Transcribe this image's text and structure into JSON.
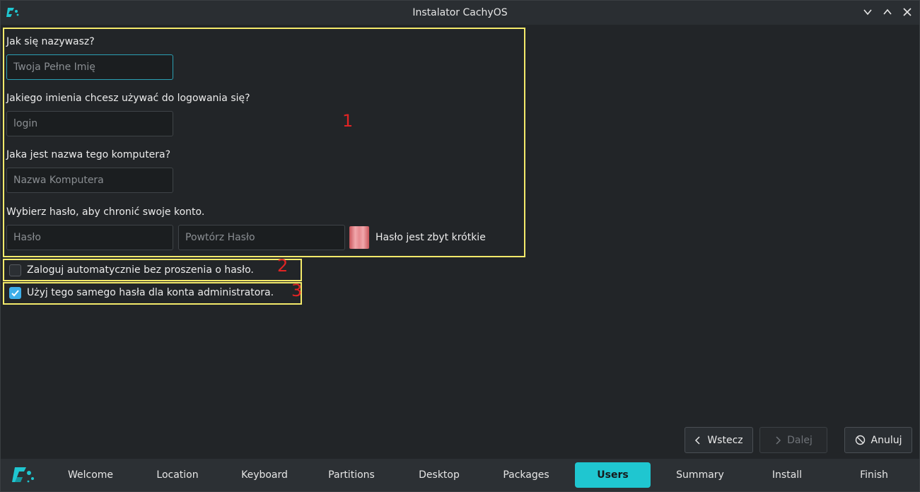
{
  "window": {
    "title": "Instalator CachyOS"
  },
  "form": {
    "name_label": "Jak się nazywasz?",
    "name_placeholder": "Twoja Pełne Imię",
    "login_label": "Jakiego imienia chcesz używać do logowania się?",
    "login_placeholder": "login",
    "host_label": "Jaka jest nazwa tego komputera?",
    "host_placeholder": "Nazwa Komputera",
    "password_label": "Wybierz hasło, aby chronić swoje konto.",
    "password_placeholder": "Hasło",
    "password_repeat_placeholder": "Powtórz Hasło",
    "password_status": "Hasło jest zbyt krótkie",
    "autologin_label": "Zaloguj automatycznie bez proszenia o hasło.",
    "autologin_checked": false,
    "same_admin_label": "Użyj tego samego hasła dla konta administratora.",
    "same_admin_checked": true
  },
  "annotations": {
    "marker_1": "1",
    "marker_2": "2",
    "marker_3": "3",
    "highlight_color": "#f4ea6a",
    "marker_color": "#e12424"
  },
  "nav_buttons": {
    "back_label": "Wstecz",
    "next_label": "Dalej",
    "cancel_label": "Anuluj"
  },
  "steps": [
    "Welcome",
    "Location",
    "Keyboard",
    "Partitions",
    "Desktop",
    "Packages",
    "Users",
    "Summary",
    "Install",
    "Finish"
  ],
  "active_step": "Users",
  "colors": {
    "accent": "#1fc6d0",
    "checkbox_accent": "#3daee9",
    "focus_border": "#2b9fb3"
  }
}
